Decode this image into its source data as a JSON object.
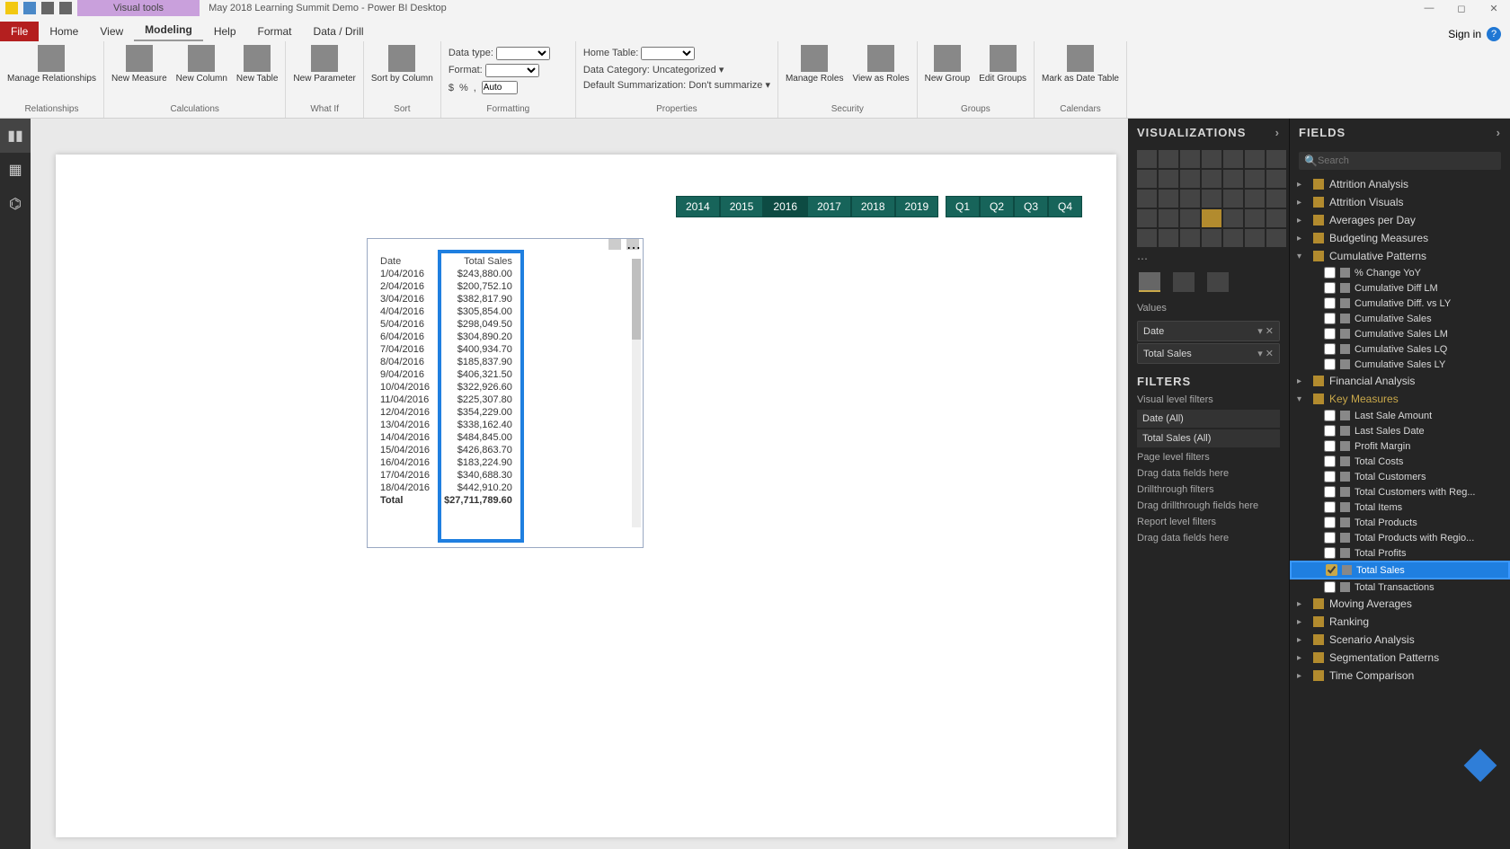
{
  "titlebar": {
    "visual_tools": "Visual tools",
    "title": "May 2018 Learning Summit Demo - Power BI Desktop"
  },
  "menu": {
    "file": "File",
    "tabs": [
      "Home",
      "View",
      "Modeling",
      "Help",
      "Format",
      "Data / Drill"
    ],
    "active": "Modeling",
    "signin": "Sign in"
  },
  "ribbon": {
    "relationships": {
      "manage": "Manage\nRelationships",
      "group": "Relationships"
    },
    "calculations": {
      "measure": "New\nMeasure",
      "column": "New\nColumn",
      "table": "New\nTable",
      "group": "Calculations"
    },
    "whatif": {
      "param": "New\nParameter",
      "group": "What If"
    },
    "sort": {
      "sort": "Sort by\nColumn",
      "group": "Sort"
    },
    "formatting": {
      "datatype_lbl": "Data type:",
      "format_lbl": "Format:",
      "currency": "$",
      "pct": "%",
      "comma": ",",
      "auto": "Auto",
      "group": "Formatting"
    },
    "properties": {
      "hometable_lbl": "Home Table:",
      "datacat_lbl": "Data Category:",
      "datacat_val": "Uncategorized",
      "summ_lbl": "Default Summarization:",
      "summ_val": "Don't summarize",
      "group": "Properties"
    },
    "security": {
      "manage": "Manage\nRoles",
      "view": "View as\nRoles",
      "group": "Security"
    },
    "groups": {
      "new": "New\nGroup",
      "edit": "Edit\nGroups",
      "group": "Groups"
    },
    "calendars": {
      "mark": "Mark as\nDate Table",
      "group": "Calendars"
    }
  },
  "slicers": {
    "years": [
      "2014",
      "2015",
      "2016",
      "2017",
      "2018",
      "2019"
    ],
    "year_selected": "2016",
    "quarters": [
      "Q1",
      "Q2",
      "Q3",
      "Q4"
    ]
  },
  "table": {
    "headers": [
      "Date",
      "Total Sales"
    ],
    "rows": [
      [
        "1/04/2016",
        "$243,880.00"
      ],
      [
        "2/04/2016",
        "$200,752.10"
      ],
      [
        "3/04/2016",
        "$382,817.90"
      ],
      [
        "4/04/2016",
        "$305,854.00"
      ],
      [
        "5/04/2016",
        "$298,049.50"
      ],
      [
        "6/04/2016",
        "$304,890.20"
      ],
      [
        "7/04/2016",
        "$400,934.70"
      ],
      [
        "8/04/2016",
        "$185,837.90"
      ],
      [
        "9/04/2016",
        "$406,321.50"
      ],
      [
        "10/04/2016",
        "$322,926.60"
      ],
      [
        "11/04/2016",
        "$225,307.80"
      ],
      [
        "12/04/2016",
        "$354,229.00"
      ],
      [
        "13/04/2016",
        "$338,162.40"
      ],
      [
        "14/04/2016",
        "$484,845.00"
      ],
      [
        "15/04/2016",
        "$426,863.70"
      ],
      [
        "16/04/2016",
        "$183,224.90"
      ],
      [
        "17/04/2016",
        "$340,688.30"
      ],
      [
        "18/04/2016",
        "$442,910.20"
      ]
    ],
    "total_label": "Total",
    "total_value": "$27,711,789.60"
  },
  "vizpane": {
    "title": "VISUALIZATIONS",
    "values_lbl": "Values",
    "wells": [
      "Date",
      "Total Sales"
    ],
    "filters_title": "FILTERS",
    "vlf": "Visual level filters",
    "vlf_items": [
      "Date (All)",
      "Total Sales (All)"
    ],
    "plf": "Page level filters",
    "dragdata": "Drag data fields here",
    "dtf": "Drillthrough filters",
    "dragdrill": "Drag drillthrough fields here",
    "rlf": "Report level filters"
  },
  "fieldspane": {
    "title": "FIELDS",
    "search_ph": "Search",
    "tables": [
      {
        "name": "Attrition Analysis",
        "exp": false
      },
      {
        "name": "Attrition Visuals",
        "exp": false
      },
      {
        "name": "Averages per Day",
        "exp": false
      },
      {
        "name": "Budgeting Measures",
        "exp": false
      },
      {
        "name": "Cumulative Patterns",
        "exp": true,
        "fields": [
          "% Change YoY",
          "Cumulative Diff LM",
          "Cumulative Diff. vs LY",
          "Cumulative Sales",
          "Cumulative Sales LM",
          "Cumulative Sales LQ",
          "Cumulative Sales LY"
        ]
      },
      {
        "name": "Financial Analysis",
        "exp": false
      },
      {
        "name": "Key Measures",
        "exp": true,
        "key": true,
        "fields": [
          "Last Sale Amount",
          "Last Sales Date",
          "Profit Margin",
          "Total Costs",
          "Total Customers",
          "Total Customers with Reg...",
          "Total Items",
          "Total Products",
          "Total Products with Regio...",
          "Total Profits",
          "Total Sales",
          "Total Transactions"
        ],
        "checked": [
          "Total Sales"
        ],
        "highlight": "Total Sales"
      },
      {
        "name": "Moving Averages",
        "exp": false
      },
      {
        "name": "Ranking",
        "exp": false
      },
      {
        "name": "Scenario Analysis",
        "exp": false
      },
      {
        "name": "Segmentation Patterns",
        "exp": false
      },
      {
        "name": "Time Comparison",
        "exp": false
      }
    ]
  }
}
